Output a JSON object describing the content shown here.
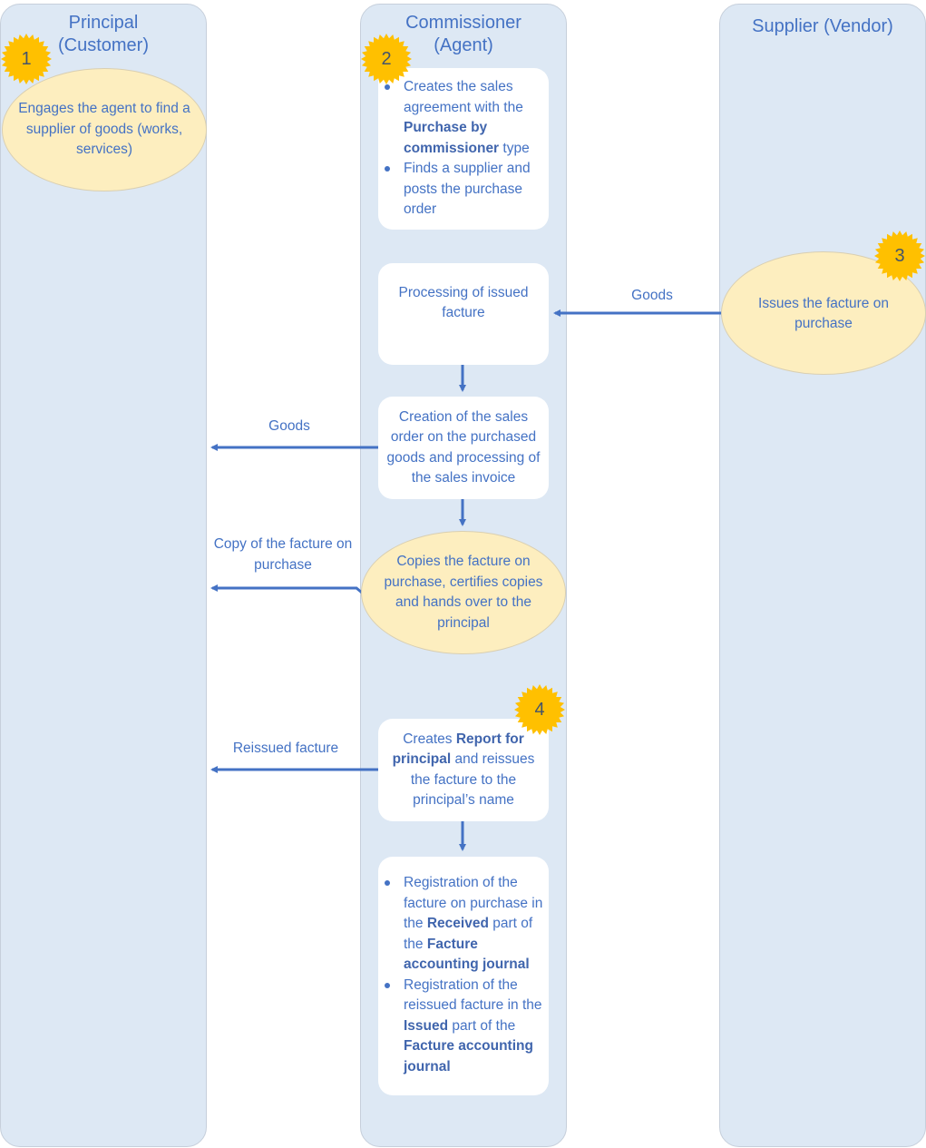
{
  "diagram": {
    "lanes": [
      {
        "id": "principal",
        "title_line1": "Principal",
        "title_line2": "(Customer)"
      },
      {
        "id": "commissioner",
        "title_line1": "Commissioner",
        "title_line2": "(Agent)"
      },
      {
        "id": "supplier",
        "title_line1": "Supplier (Vendor)"
      }
    ],
    "steps": {
      "step1": {
        "badge": "1",
        "text": "Engages the agent to find a supplier of goods (works, services)"
      },
      "step2": {
        "badge": "2",
        "bullet1": {
          "pre": "Creates the sales agreement with the ",
          "bold": "Purchase by commissioner",
          "post": " type"
        },
        "bullet2": {
          "text": "Finds a supplier and posts the purchase order"
        }
      },
      "step3": {
        "badge": "3",
        "text": "Issues the facture on purchase"
      },
      "processing": {
        "text": "Processing of issued facture"
      },
      "sales_order": {
        "text": "Creation of the sales order on the purchased goods and processing of the sales invoice"
      },
      "copies": {
        "text": "Copies the facture on purchase, certifies copies and hands over to the principal"
      },
      "step4": {
        "badge": "4",
        "pre": "Creates ",
        "bold": "Report for principal",
        "post": " and reissues the facture to the principal’s name"
      },
      "registration": {
        "bullet1": {
          "pre": "Registration of the facture on purchase in the ",
          "bold1": "Received",
          "mid": " part of the ",
          "bold2": "Facture accounting journal"
        },
        "bullet2": {
          "pre": "Registration of the reissued facture in the ",
          "bold1": "Issued",
          "mid": " part of the ",
          "bold2": "Facture accounting journal"
        }
      }
    },
    "flows": [
      {
        "id": "goods-from-supplier",
        "label": "Goods"
      },
      {
        "id": "goods-to-principal",
        "label": "Goods"
      },
      {
        "id": "copy-to-principal",
        "label": "Copy of the facture on purchase"
      },
      {
        "id": "reissued-to-principal",
        "label": "Reissued facture"
      }
    ],
    "colors": {
      "lane_fill": "#dde8f4",
      "text": "#4472c4",
      "ellipse_fill": "#fdeebf",
      "badge_fill": "#ffc000",
      "arrow": "#4472c4"
    }
  }
}
